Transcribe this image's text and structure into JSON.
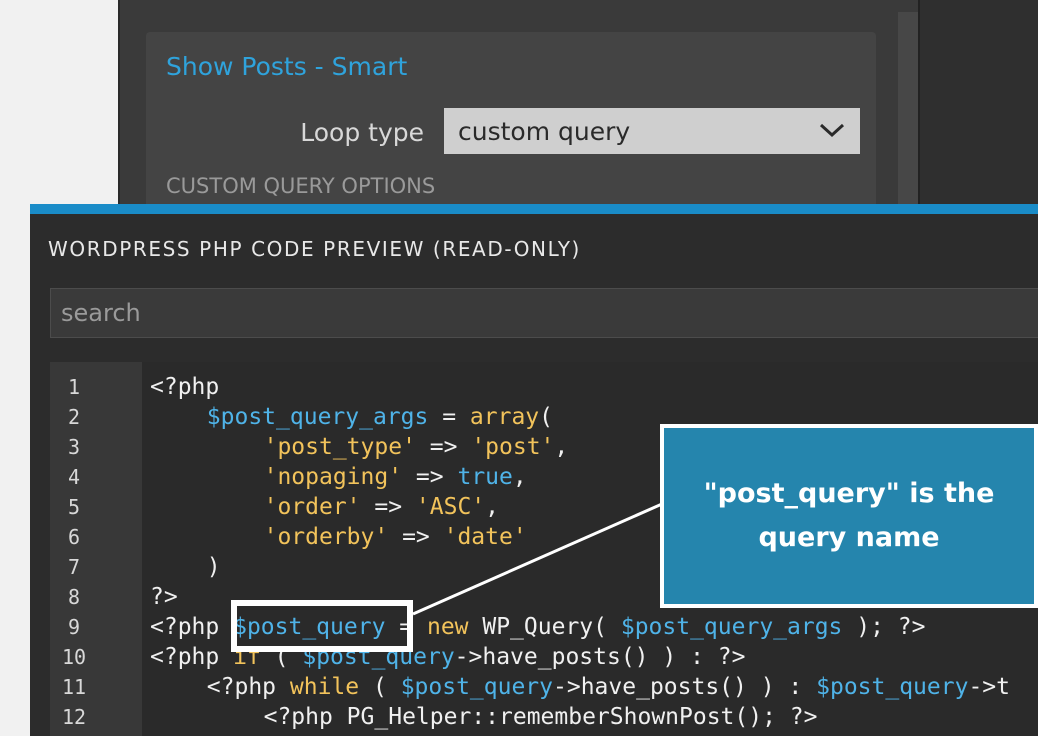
{
  "settings": {
    "section_title": "Show Posts - Smart",
    "loop_type_label": "Loop type",
    "loop_type_value": "custom query",
    "custom_query_header": "CUSTOM QUERY OPTIONS"
  },
  "modal": {
    "title": "WORDPRESS PHP CODE PREVIEW (READ-ONLY)",
    "search_placeholder": "search"
  },
  "code_lines": [
    {
      "n": "1",
      "indent": 0,
      "tokens": [
        {
          "t": "<?php",
          "c": "plain"
        }
      ]
    },
    {
      "n": "2",
      "indent": 4,
      "tokens": [
        {
          "t": "$post_query_args",
          "c": "var"
        },
        {
          "t": " = ",
          "c": "plain"
        },
        {
          "t": "array",
          "c": "kw"
        },
        {
          "t": "(",
          "c": "plain"
        }
      ]
    },
    {
      "n": "3",
      "indent": 8,
      "tokens": [
        {
          "t": "'post_type'",
          "c": "str"
        },
        {
          "t": " => ",
          "c": "plain"
        },
        {
          "t": "'post'",
          "c": "str"
        },
        {
          "t": ",",
          "c": "plain"
        }
      ]
    },
    {
      "n": "4",
      "indent": 8,
      "tokens": [
        {
          "t": "'nopaging'",
          "c": "str"
        },
        {
          "t": " => ",
          "c": "plain"
        },
        {
          "t": "true",
          "c": "var"
        },
        {
          "t": ",",
          "c": "plain"
        }
      ]
    },
    {
      "n": "5",
      "indent": 8,
      "tokens": [
        {
          "t": "'order'",
          "c": "str"
        },
        {
          "t": " => ",
          "c": "plain"
        },
        {
          "t": "'ASC'",
          "c": "str"
        },
        {
          "t": ",",
          "c": "plain"
        }
      ]
    },
    {
      "n": "6",
      "indent": 8,
      "tokens": [
        {
          "t": "'orderby'",
          "c": "str"
        },
        {
          "t": " => ",
          "c": "plain"
        },
        {
          "t": "'date'",
          "c": "str"
        }
      ]
    },
    {
      "n": "7",
      "indent": 4,
      "tokens": [
        {
          "t": ")",
          "c": "plain"
        }
      ]
    },
    {
      "n": "8",
      "indent": 0,
      "tokens": [
        {
          "t": "?>",
          "c": "plain"
        }
      ]
    },
    {
      "n": "9",
      "indent": 0,
      "tokens": [
        {
          "t": "<?php ",
          "c": "plain"
        },
        {
          "t": "$post_query",
          "c": "var"
        },
        {
          "t": " = ",
          "c": "plain"
        },
        {
          "t": "new",
          "c": "kw"
        },
        {
          "t": " WP_Query( ",
          "c": "plain"
        },
        {
          "t": "$post_query_args",
          "c": "var"
        },
        {
          "t": " ); ?>",
          "c": "plain"
        }
      ]
    },
    {
      "n": "10",
      "indent": 0,
      "tokens": [
        {
          "t": "<?php ",
          "c": "plain"
        },
        {
          "t": "if",
          "c": "kw"
        },
        {
          "t": " ( ",
          "c": "plain"
        },
        {
          "t": "$post_query",
          "c": "var"
        },
        {
          "t": "->have_posts() ) : ?>",
          "c": "plain"
        }
      ]
    },
    {
      "n": "11",
      "indent": 4,
      "tokens": [
        {
          "t": "<?php ",
          "c": "plain"
        },
        {
          "t": "while",
          "c": "kw"
        },
        {
          "t": " ( ",
          "c": "plain"
        },
        {
          "t": "$post_query",
          "c": "var"
        },
        {
          "t": "->have_posts() ) : ",
          "c": "plain"
        },
        {
          "t": "$post_query",
          "c": "var"
        },
        {
          "t": "->t",
          "c": "plain"
        }
      ]
    },
    {
      "n": "12",
      "indent": 8,
      "tokens": [
        {
          "t": "<?php PG_Helper::rememberShownPost(); ?>",
          "c": "plain"
        }
      ]
    }
  ],
  "callout": {
    "line1": "\"post_query\" is the",
    "line2": "query name"
  },
  "colors": {
    "accent": "#1a8cc8",
    "section_title": "#2fa3dc",
    "callout_bg": "#2585ad",
    "var": "#4fb3e8",
    "string": "#f2c35b"
  }
}
